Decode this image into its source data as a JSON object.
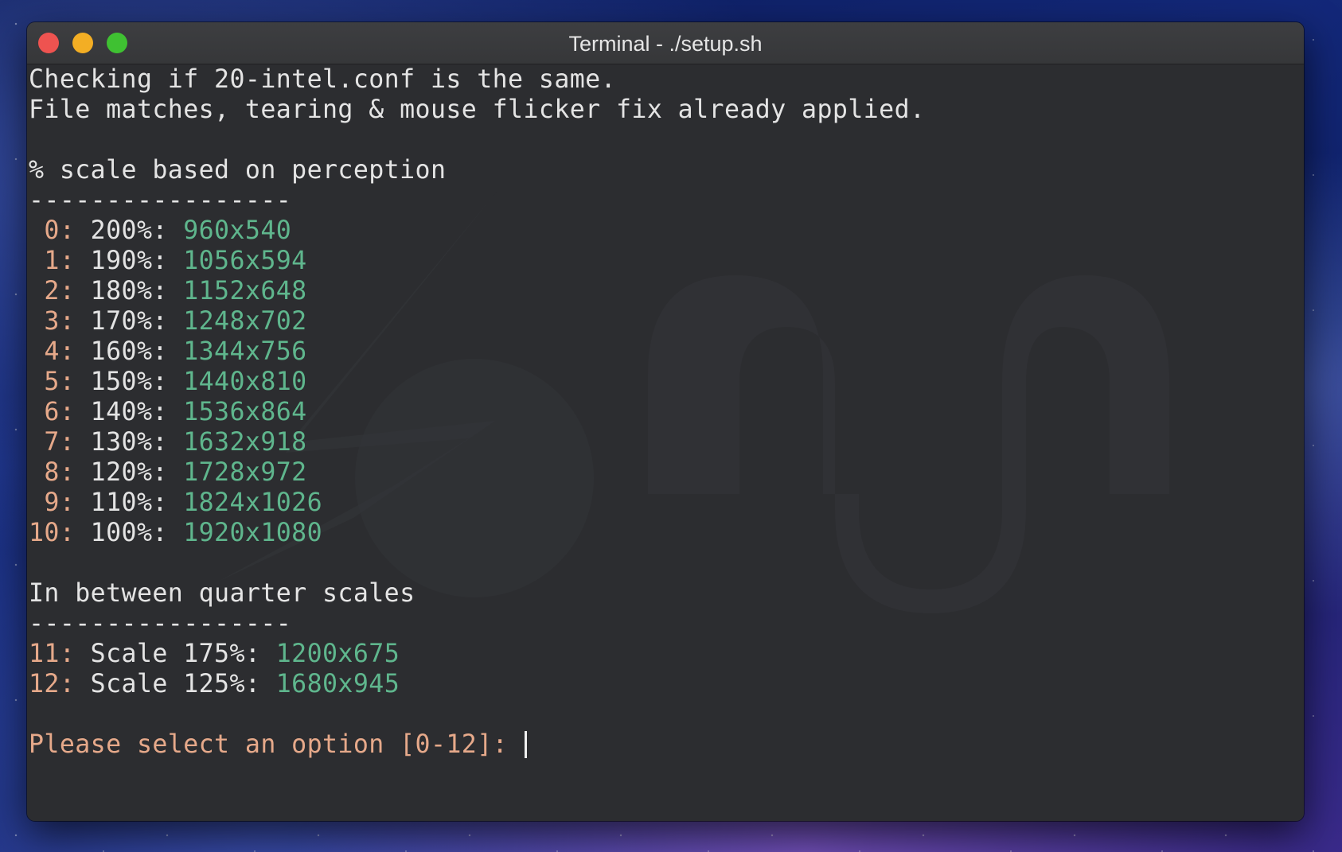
{
  "window": {
    "title": "Terminal - ./setup.sh"
  },
  "terminal": {
    "intro": [
      "Checking if 20-intel.conf is the same.",
      "File matches, tearing & mouse flicker fix already applied."
    ],
    "section1_heading": "% scale based on perception",
    "separator1": "-----------------",
    "options": [
      {
        "num": " 0:",
        "pct": " 200%:",
        "res": "960x540"
      },
      {
        "num": " 1:",
        "pct": " 190%:",
        "res": "1056x594"
      },
      {
        "num": " 2:",
        "pct": " 180%:",
        "res": "1152x648"
      },
      {
        "num": " 3:",
        "pct": " 170%:",
        "res": "1248x702"
      },
      {
        "num": " 4:",
        "pct": " 160%:",
        "res": "1344x756"
      },
      {
        "num": " 5:",
        "pct": " 150%:",
        "res": "1440x810"
      },
      {
        "num": " 6:",
        "pct": " 140%:",
        "res": "1536x864"
      },
      {
        "num": " 7:",
        "pct": " 130%:",
        "res": "1632x918"
      },
      {
        "num": " 8:",
        "pct": " 120%:",
        "res": "1728x972"
      },
      {
        "num": " 9:",
        "pct": " 110%:",
        "res": "1824x1026"
      },
      {
        "num": "10:",
        "pct": " 100%:",
        "res": "1920x1080"
      }
    ],
    "section2_heading": "In between quarter scales",
    "separator2": "-----------------",
    "quarter_options": [
      {
        "num": "11:",
        "pct": " Scale 175%:",
        "res": "1200x675"
      },
      {
        "num": "12:",
        "pct": " Scale 125%:",
        "res": "1680x945"
      }
    ],
    "prompt": "Please select an option [0-12]: "
  },
  "colors": {
    "terminal_bg": "#2c2d30",
    "text": "#e4e4e4",
    "number_accent": "#e6a98a",
    "resolution_accent": "#5fb68d"
  }
}
